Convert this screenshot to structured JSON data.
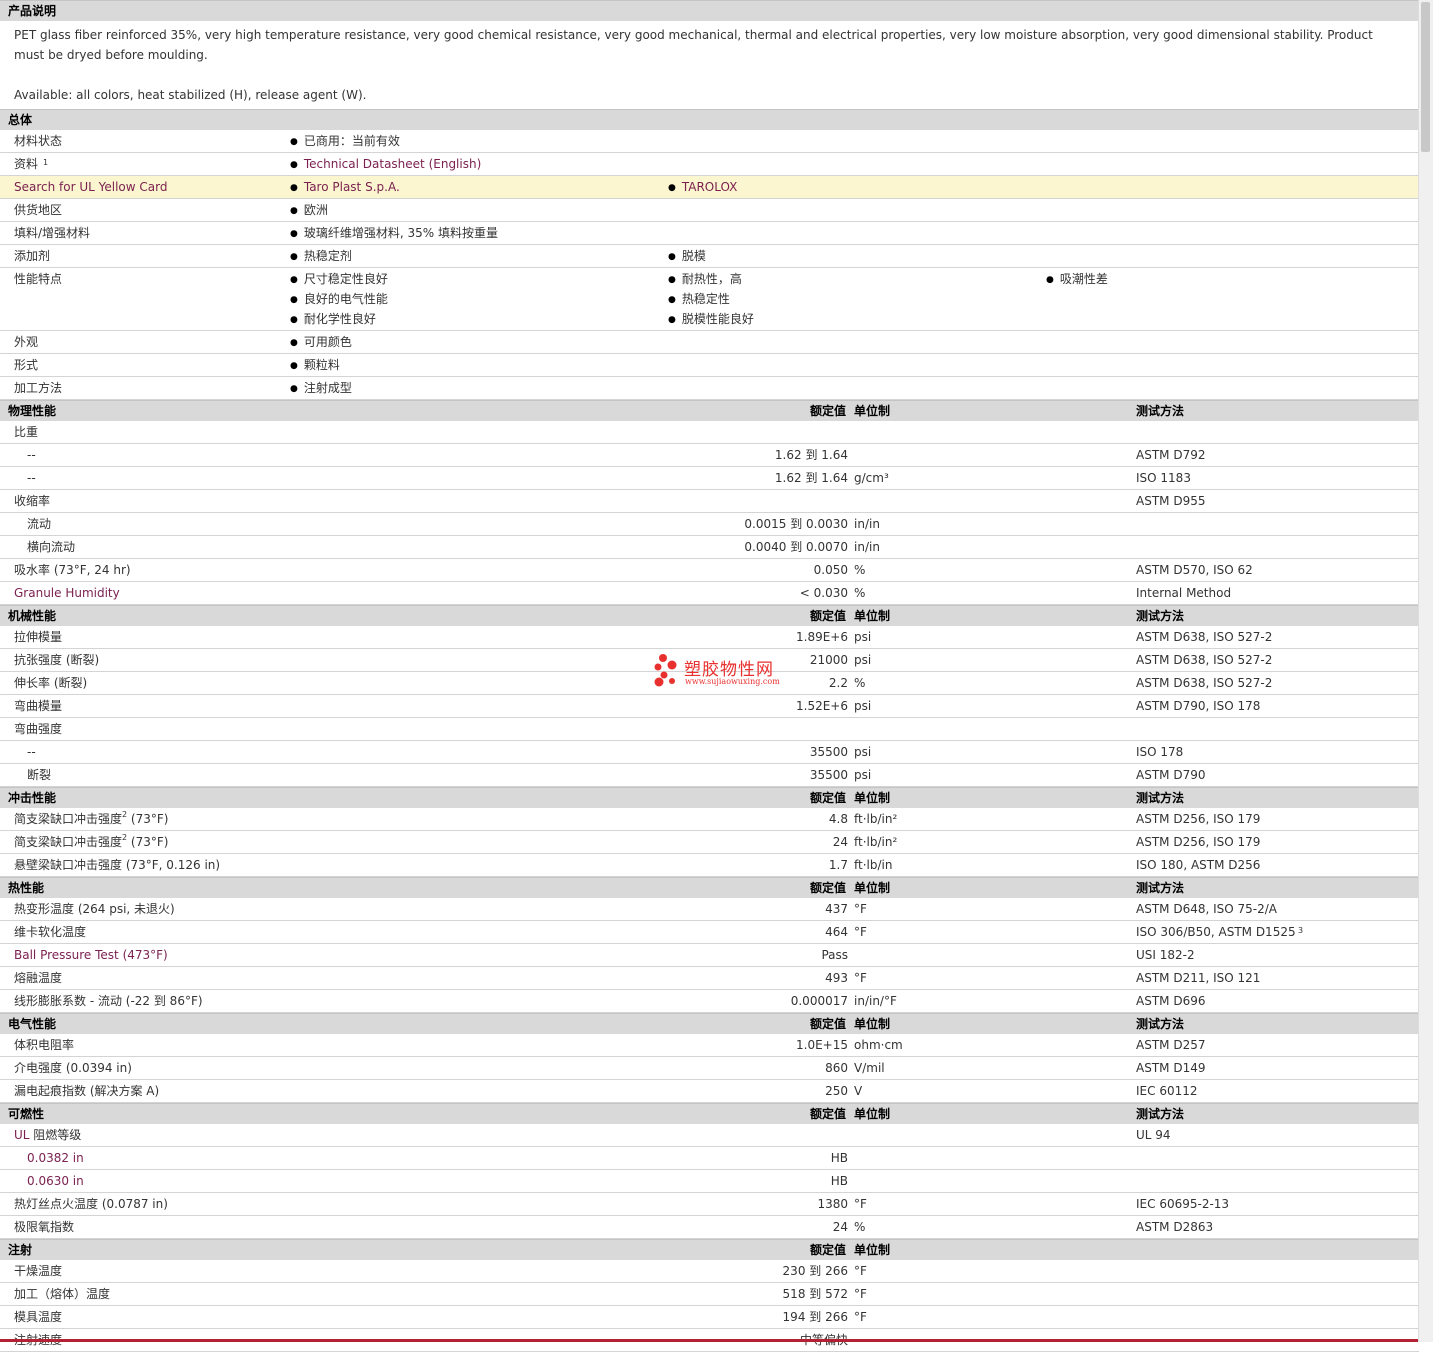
{
  "description": {
    "title": "产品说明",
    "text": "PET glass fiber reinforced 35%, very high temperature resistance, very good chemical resistance, very good mechanical, thermal and electrical properties, very low moisture absorption, very good dimensional stability. Product must be dryed before moulding.",
    "available": "Available: all colors, heat stabilized (H), release agent (W)."
  },
  "general": {
    "title": "总体",
    "rows": [
      {
        "label": "材料状态",
        "items": [
          "已商用：当前有效"
        ]
      },
      {
        "label": "资料",
        "sup": "1",
        "items": [
          "Technical Datasheet (English)"
        ]
      },
      {
        "label": "Search for UL Yellow Card",
        "items": [
          "Taro Plast S.p.A.",
          "TAROLOX"
        ]
      },
      {
        "label": "供货地区",
        "items": [
          "欧洲"
        ]
      },
      {
        "label": "填料/增强材料",
        "items": [
          "玻璃纤维增强材料, 35% 填料按重量"
        ]
      },
      {
        "label": "添加剂",
        "items": [
          "热稳定剂",
          "脱模"
        ]
      },
      {
        "label": "性能特点",
        "items": [
          "尺寸稳定性良好",
          "耐热性，高",
          "吸潮性差",
          "良好的电气性能",
          "热稳定性",
          "耐化学性良好",
          "脱模性能良好"
        ]
      },
      {
        "label": "外观",
        "items": [
          "可用颜色"
        ]
      },
      {
        "label": "形式",
        "items": [
          "颗粒料"
        ]
      },
      {
        "label": "加工方法",
        "items": [
          "注射成型"
        ]
      }
    ]
  },
  "headers": {
    "value": "额定值",
    "unit": "单位制",
    "test": "测试方法"
  },
  "sections": [
    {
      "title": "物理性能",
      "rows": [
        {
          "label": "比重",
          "value": "",
          "unit": "",
          "test": ""
        },
        {
          "label": "--",
          "sub": true,
          "value": "1.62 到  1.64",
          "unit": "",
          "test": "ASTM D792"
        },
        {
          "label": "--",
          "sub": true,
          "value": "1.62 到  1.64",
          "unit": "g/cm³",
          "test": "ISO 1183"
        },
        {
          "label": "收缩率",
          "value": "",
          "unit": "",
          "test": "ASTM D955"
        },
        {
          "label": "流动",
          "sub": true,
          "value": "0.0015 到  0.0030",
          "unit": "in/in",
          "test": ""
        },
        {
          "label": "横向流动",
          "sub": true,
          "value": "0.0040 到  0.0070",
          "unit": "in/in",
          "test": ""
        },
        {
          "label": "吸水率  (73°F, 24 hr)",
          "value": "0.050",
          "unit": "%",
          "test": "ASTM D570, ISO 62"
        },
        {
          "label": "Granule Humidity",
          "link": true,
          "value": "< 0.030",
          "unit": "%",
          "test": "Internal Method"
        }
      ]
    },
    {
      "title": "机械性能",
      "rows": [
        {
          "label": "拉伸模量",
          "value": "1.89E+6",
          "unit": "psi",
          "test": "ASTM D638, ISO 527-2"
        },
        {
          "label": "抗张强度  (断裂)",
          "value": "21000",
          "unit": "psi",
          "test": "ASTM D638, ISO 527-2"
        },
        {
          "label": "伸长率  (断裂)",
          "value": "2.2",
          "unit": "%",
          "test": "ASTM D638, ISO 527-2"
        },
        {
          "label": "弯曲模量",
          "value": "1.52E+6",
          "unit": "psi",
          "test": "ASTM D790, ISO 178"
        },
        {
          "label": "弯曲强度",
          "value": "",
          "unit": "",
          "test": ""
        },
        {
          "label": "--",
          "sub": true,
          "value": "35500",
          "unit": "psi",
          "test": "ISO 178"
        },
        {
          "label": "断裂",
          "sub": true,
          "value": "35500",
          "unit": "psi",
          "test": "ASTM D790"
        }
      ]
    },
    {
      "title": "冲击性能",
      "rows": [
        {
          "label": "简支梁缺口冲击强度",
          "sup": "2",
          "suffix": " (73°F)",
          "value": "4.8",
          "unit": "ft·lb/in²",
          "test": "ASTM D256, ISO 179"
        },
        {
          "label": "简支梁缺口冲击强度",
          "sup": "2",
          "suffix": " (73°F)",
          "value": "24",
          "unit": "ft·lb/in²",
          "test": "ASTM D256, ISO 179"
        },
        {
          "label": "悬壁梁缺口冲击强度  (73°F, 0.126 in)",
          "value": "1.7",
          "unit": "ft·lb/in",
          "test": "ISO 180, ASTM D256"
        }
      ]
    },
    {
      "title": "热性能",
      "rows": [
        {
          "label": "热变形温度  (264 psi, 未退火)",
          "value": "437",
          "unit": "°F",
          "test": "ASTM D648, ISO 75-2/A"
        },
        {
          "label": "维卡软化温度",
          "value": "464",
          "unit": "°F",
          "test": "ISO 306/B50, ASTM D1525",
          "testSup": "3"
        },
        {
          "label": "Ball Pressure Test (473°F)",
          "link": true,
          "value": "Pass",
          "unit": "",
          "test": "USI 182-2"
        },
        {
          "label": "熔融温度",
          "value": "493",
          "unit": "°F",
          "test": "ASTM D211, ISO 121"
        },
        {
          "label": "线形膨胀系数  - 流动  (-22 到  86°F)",
          "value": "0.000017",
          "unit": "in/in/°F",
          "test": "ASTM D696"
        }
      ]
    },
    {
      "title": "电气性能",
      "rows": [
        {
          "label": "体积电阻率",
          "value": "1.0E+15",
          "unit": "ohm·cm",
          "test": "ASTM D257"
        },
        {
          "label": "介电强度  (0.0394 in)",
          "value": "860",
          "unit": "V/mil",
          "test": "ASTM D149"
        },
        {
          "label": "漏电起痕指数  (解决方案  A)",
          "value": "250",
          "unit": "V",
          "test": "IEC 60112"
        }
      ]
    },
    {
      "title": "可燃性",
      "rows": [
        {
          "label": "UL 阻燃等级",
          "ulLink": true,
          "value": "",
          "unit": "",
          "test": "UL 94"
        },
        {
          "label": "0.0382 in",
          "sub": true,
          "link": true,
          "value": "HB",
          "unit": "",
          "test": ""
        },
        {
          "label": "0.0630 in",
          "sub": true,
          "link": true,
          "value": "HB",
          "unit": "",
          "test": ""
        },
        {
          "label": "热灯丝点火温度  (0.0787 in)",
          "value": "1380",
          "unit": "°F",
          "test": "IEC 60695-2-13"
        },
        {
          "label": "极限氧指数",
          "value": "24",
          "unit": "%",
          "test": "ASTM D2863"
        }
      ]
    },
    {
      "title": "注射",
      "rows": [
        {
          "label": "干燥温度",
          "value": "230 到  266",
          "unit": "°F",
          "test": ""
        },
        {
          "label": "加工（熔体）温度",
          "value": "518 到  572",
          "unit": "°F",
          "test": ""
        },
        {
          "label": "模具温度",
          "value": "194 到  266",
          "unit": "°F",
          "test": ""
        },
        {
          "label": "注射速度",
          "value": "中等偏快",
          "unit": "",
          "test": ""
        }
      ]
    }
  ],
  "watermark": {
    "cn": "塑胶物性网",
    "url": "www.sujiaowuxing.com"
  }
}
